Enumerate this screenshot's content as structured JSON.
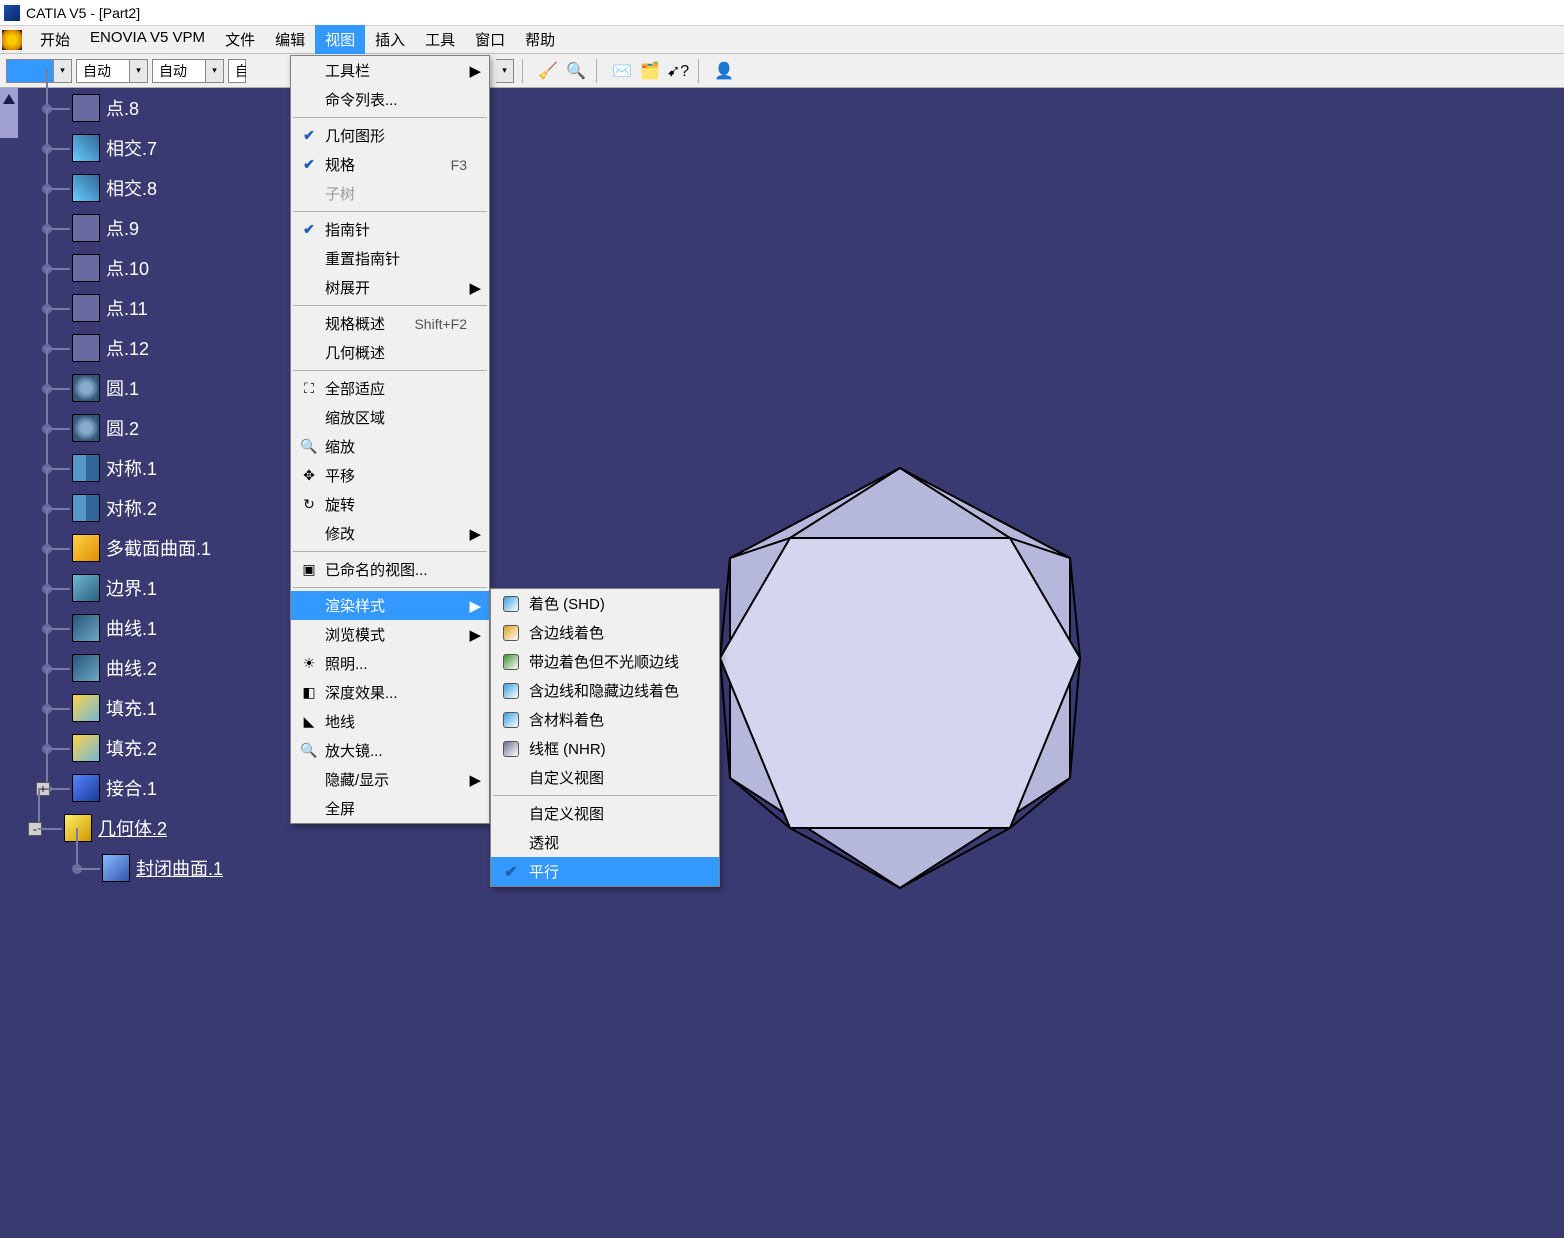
{
  "app": {
    "title": "CATIA V5 - [Part2]"
  },
  "menubar": {
    "items": [
      {
        "id": "start",
        "label": "开始"
      },
      {
        "id": "enovia",
        "label": "ENOVIA V5 VPM"
      },
      {
        "id": "file",
        "label": "文件"
      },
      {
        "id": "edit",
        "label": "编辑"
      },
      {
        "id": "view",
        "label": "视图",
        "active": true
      },
      {
        "id": "insert",
        "label": "插入"
      },
      {
        "id": "tools",
        "label": "工具"
      },
      {
        "id": "window",
        "label": "窗口"
      },
      {
        "id": "help",
        "label": "帮助"
      }
    ]
  },
  "toolbar": {
    "combo1": "自动",
    "combo2": "自动",
    "combo3_partial": "自"
  },
  "tree": {
    "nodes": [
      {
        "id": "pt8",
        "icon": "point",
        "label": "点.8"
      },
      {
        "id": "int7",
        "icon": "inter",
        "label": "相交.7"
      },
      {
        "id": "int8",
        "icon": "inter",
        "label": "相交.8"
      },
      {
        "id": "pt9",
        "icon": "point",
        "label": "点.9"
      },
      {
        "id": "pt10",
        "icon": "point",
        "label": "点.10"
      },
      {
        "id": "pt11",
        "icon": "point",
        "label": "点.11"
      },
      {
        "id": "pt12",
        "icon": "point",
        "label": "点.12"
      },
      {
        "id": "c1",
        "icon": "circ",
        "label": "圆.1"
      },
      {
        "id": "c2",
        "icon": "circ",
        "label": "圆.2"
      },
      {
        "id": "s1",
        "icon": "sym",
        "label": "对称.1"
      },
      {
        "id": "s2",
        "icon": "sym",
        "label": "对称.2"
      },
      {
        "id": "ms1",
        "icon": "multi",
        "label": "多截面曲面.1"
      },
      {
        "id": "b1",
        "icon": "bnd",
        "label": "边界.1"
      },
      {
        "id": "cv1",
        "icon": "curve",
        "label": "曲线.1"
      },
      {
        "id": "cv2",
        "icon": "curve",
        "label": "曲线.2"
      },
      {
        "id": "f1",
        "icon": "fill",
        "label": "填充.1"
      },
      {
        "id": "f2",
        "icon": "fill",
        "label": "填充.2"
      },
      {
        "id": "j1",
        "icon": "join",
        "label": "接合.1",
        "expand": "+"
      }
    ],
    "body": {
      "label": "几何体.2",
      "expand": "-"
    },
    "closed": {
      "label": "封闭曲面.1"
    }
  },
  "view_menu": {
    "groups": [
      [
        {
          "label": "工具栏",
          "arrow": true
        },
        {
          "label": "命令列表..."
        }
      ],
      [
        {
          "label": "几何图形",
          "check": true
        },
        {
          "label": "规格",
          "check": true,
          "accel": "F3"
        },
        {
          "label": "子树",
          "disabled": true
        }
      ],
      [
        {
          "label": "指南针",
          "check": true
        },
        {
          "label": "重置指南针"
        },
        {
          "label": "树展开",
          "arrow": true
        }
      ],
      [
        {
          "label": "规格概述",
          "accel": "Shift+F2"
        },
        {
          "label": "几何概述"
        }
      ],
      [
        {
          "label": "全部适应",
          "iconglyph": "⛶"
        },
        {
          "label": "缩放区域"
        },
        {
          "label": "缩放",
          "iconglyph": "🔍"
        },
        {
          "label": "平移",
          "iconglyph": "✥"
        },
        {
          "label": "旋转",
          "iconglyph": "↻"
        },
        {
          "label": "修改",
          "arrow": true
        }
      ],
      [
        {
          "label": "已命名的视图...",
          "iconglyph": "▣"
        }
      ],
      [
        {
          "label": "渲染样式",
          "arrow": true,
          "highlight": true
        },
        {
          "label": "浏览模式",
          "arrow": true
        },
        {
          "label": "照明...",
          "iconglyph": "☀"
        },
        {
          "label": "深度效果...",
          "iconglyph": "◧"
        },
        {
          "label": "地线",
          "iconglyph": "◣"
        },
        {
          "label": "放大镜...",
          "iconglyph": "🔍"
        },
        {
          "label": "隐藏/显示",
          "arrow": true
        },
        {
          "label": "全屏"
        }
      ]
    ]
  },
  "render_submenu": {
    "groups": [
      [
        {
          "label": "着色 (SHD)",
          "iconcolor": "#3aa0e0"
        },
        {
          "label": "含边线着色",
          "iconcolor": "#e0a020"
        },
        {
          "label": "带边着色但不光顺边线",
          "iconcolor": "#409030"
        },
        {
          "label": "含边线和隐藏边线着色",
          "iconcolor": "#3aa0e0"
        },
        {
          "label": "含材料着色",
          "iconcolor": "#3aa0e0"
        },
        {
          "label": "线框 (NHR)",
          "iconcolor": "#707090"
        },
        {
          "label": "自定义视图"
        }
      ],
      [
        {
          "label": "自定义视图"
        },
        {
          "label": "透视"
        },
        {
          "label": "平行",
          "check": true,
          "highlight": true
        }
      ]
    ]
  }
}
